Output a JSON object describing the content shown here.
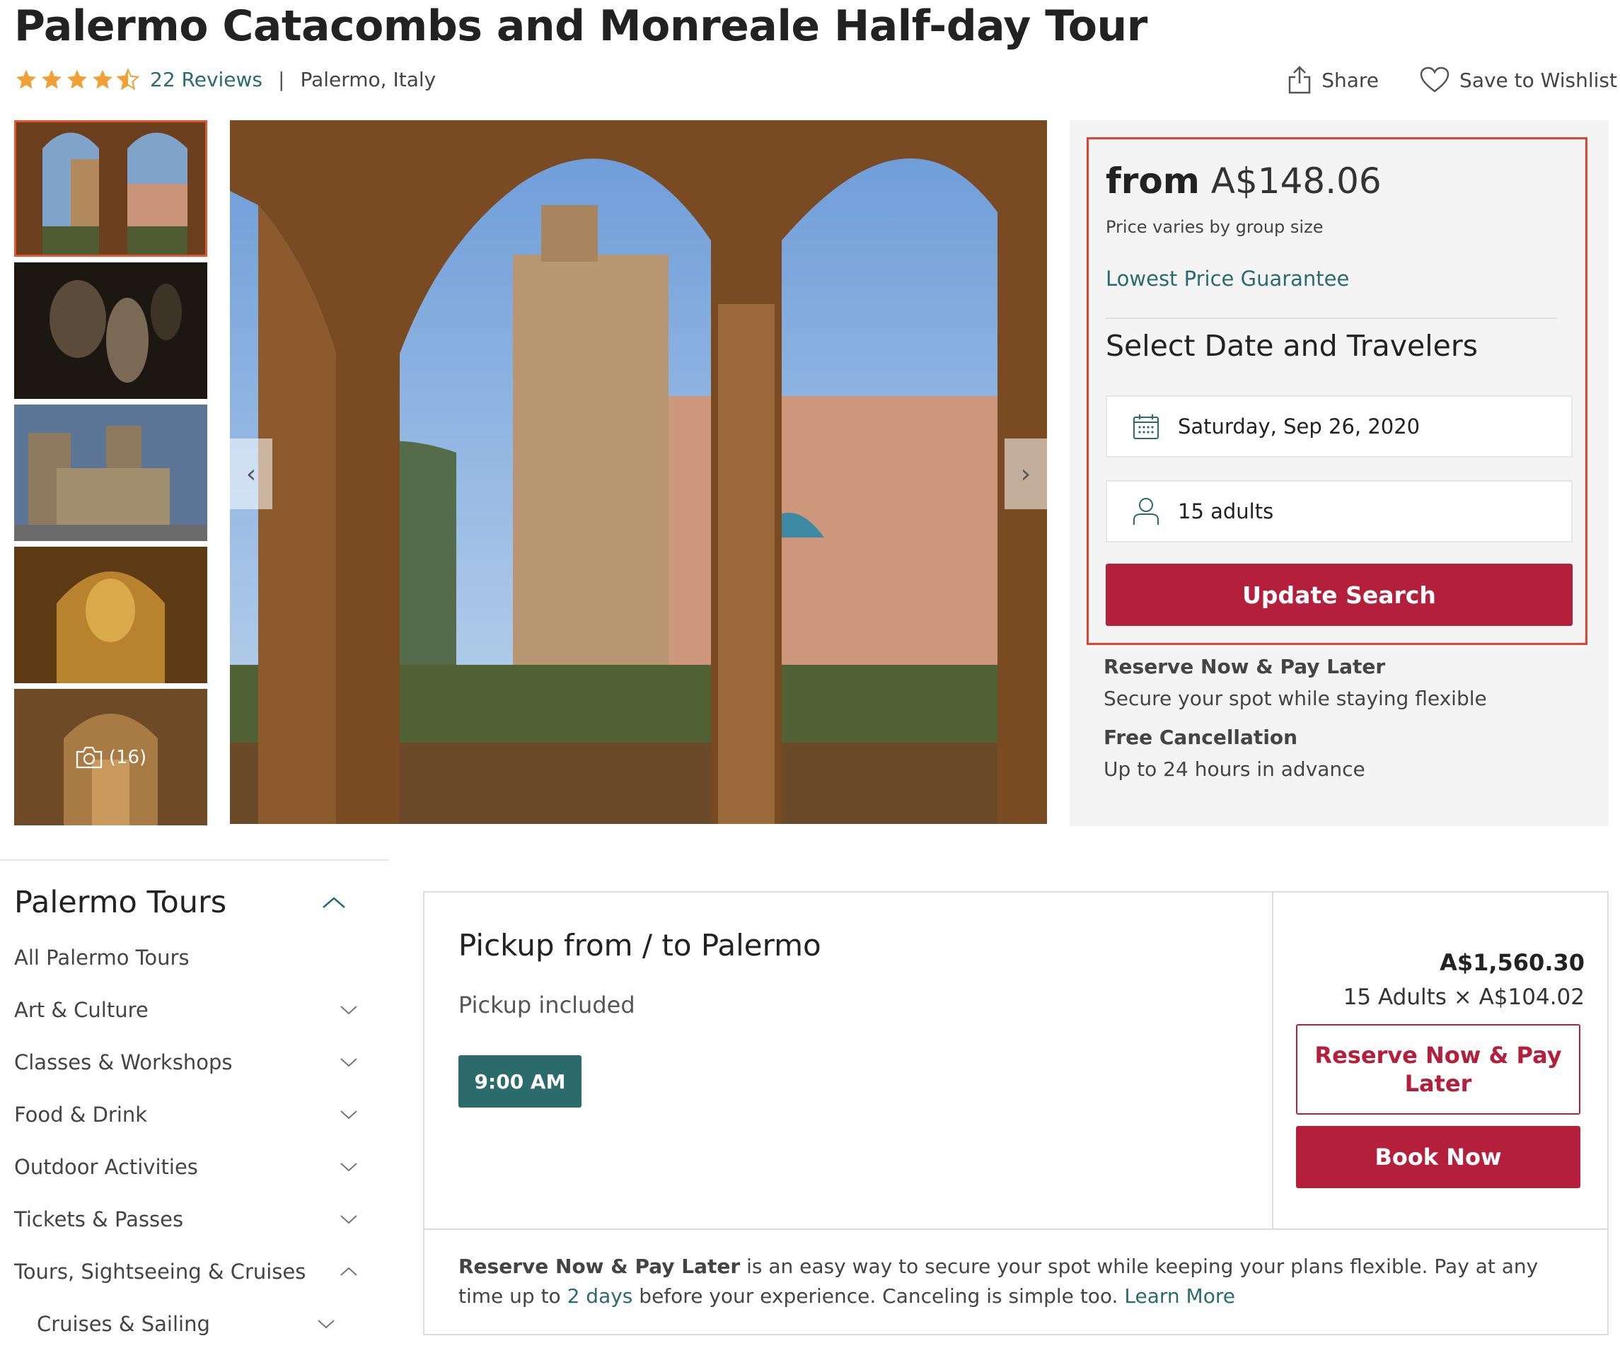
{
  "header": {
    "title": "Palermo Catacombs and Monreale Half-day Tour",
    "rating": 4.5,
    "reviews_label": "22 Reviews",
    "separator": "|",
    "location": "Palermo, Italy",
    "share_label": "Share",
    "wishlist_label": "Save to Wishlist"
  },
  "gallery": {
    "photo_count_label": "(16)"
  },
  "booking": {
    "price_prefix": "from",
    "price_value": "A$148.06",
    "price_note": "Price varies by group size",
    "guarantee_label": "Lowest Price Guarantee",
    "select_title": "Select Date and Travelers",
    "date_value": "Saturday, Sep 26, 2020",
    "travelers_value": "15 adults",
    "update_button": "Update Search",
    "perks": [
      {
        "title": "Reserve Now & Pay Later",
        "text": "Secure your spot while staying flexible"
      },
      {
        "title": "Free Cancellation",
        "text": "Up to 24 hours in advance"
      }
    ]
  },
  "sidebar": {
    "heading": "Palermo Tours",
    "items": [
      {
        "label": "All Palermo Tours"
      },
      {
        "label": "Art & Culture"
      },
      {
        "label": "Classes & Workshops"
      },
      {
        "label": "Food & Drink"
      },
      {
        "label": "Outdoor Activities"
      },
      {
        "label": "Tickets & Passes"
      },
      {
        "label": "Tours, Sightseeing & Cruises"
      },
      {
        "label": "Cruises & Sailing"
      }
    ]
  },
  "option": {
    "title": "Pickup from / to Palermo",
    "subtitle": "Pickup included",
    "time_label": "9:00 AM",
    "total": "A$1,560.30",
    "breakdown": "15 Adults × A$104.02",
    "reserve_button": "Reserve Now & Pay Later",
    "book_button": "Book Now",
    "footer_bold": "Reserve Now & Pay Later",
    "footer_text_1": " is an easy way to secure your spot while keeping your plans flexible. Pay at any time up to ",
    "footer_days": "2 days",
    "footer_text_2": " before your experience. Canceling is simple too. ",
    "footer_link": "Learn More"
  },
  "colors": {
    "accent_red": "#b41f3c",
    "teal": "#2a6b6f",
    "highlight_border": "#e2452f",
    "star": "#f0a035"
  }
}
